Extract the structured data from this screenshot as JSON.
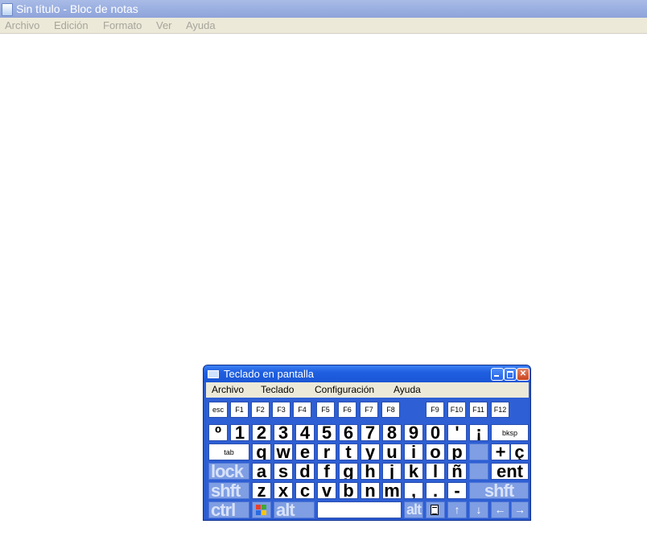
{
  "notepad": {
    "title": "Sin título - Bloc de notas",
    "menu": [
      "Archivo",
      "Edición",
      "Formato",
      "Ver",
      "Ayuda"
    ],
    "text": ""
  },
  "osk": {
    "title": "Teclado en pantalla",
    "menu": [
      "Archivo",
      "Teclado",
      "Configuración",
      "Ayuda"
    ],
    "fkeys": [
      "esc",
      "F1",
      "F2",
      "F3",
      "F4",
      "F5",
      "F6",
      "F7",
      "F8",
      "F9",
      "F10",
      "F11",
      "F12"
    ],
    "row1": [
      "º",
      "1",
      "2",
      "3",
      "4",
      "5",
      "6",
      "7",
      "8",
      "9",
      "0",
      "'",
      "¡"
    ],
    "bksp": "bksp",
    "tab": "tab",
    "row2": [
      "q",
      "w",
      "e",
      "r",
      "t",
      "y",
      "u",
      "i",
      "o",
      "p"
    ],
    "row2_end": [
      "+",
      "ç"
    ],
    "lock": "lock",
    "row3": [
      "a",
      "s",
      "d",
      "f",
      "g",
      "h",
      "j",
      "k",
      "l",
      "ñ"
    ],
    "ent": "ent",
    "shft": "shft",
    "row4": [
      "z",
      "x",
      "c",
      "v",
      "b",
      "n",
      "m",
      ",",
      ".",
      "-"
    ],
    "ctrl": "ctrl",
    "alt": "alt",
    "altgr": "alt",
    "arrows": [
      "↑",
      "↓",
      "←",
      "→"
    ],
    "window_buttons": [
      "minimize-icon",
      "maximize-icon",
      "close-icon"
    ]
  }
}
